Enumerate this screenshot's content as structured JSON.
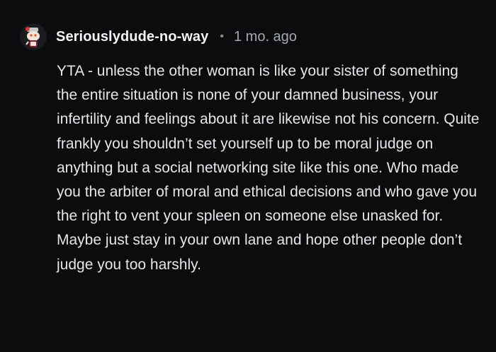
{
  "comment": {
    "username": "Seriouslydude-no-way",
    "separator": "•",
    "time_ago": "1 mo. ago",
    "avatar_icon": "snoo-avatar-icon",
    "body": "YTA - unless the other woman is like your sister of something the entire situation is none of your damned business, your infertility and feelings about it are likewise not his concern. Quite frankly you shouldn’t set yourself up to be moral judge on anything but a social networking site like this one. Who made you the arbiter of moral and ethical decisions and who gave you the right to vent your spleen on someone else unasked for. Maybe just stay in your own lane and hope other people don’t judge you too harshly."
  },
  "colors": {
    "background": "#0b0c0e",
    "text": "#e4e6e8",
    "meta": "#a4a9ae"
  }
}
